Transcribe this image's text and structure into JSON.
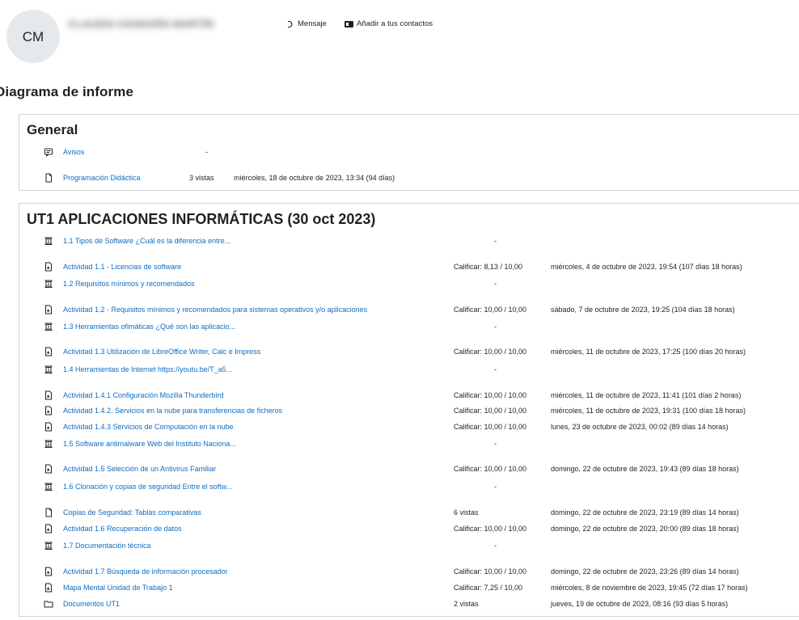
{
  "profile": {
    "initials": "CM",
    "name": "CLAUDIA SANDAÑA MARTÍN",
    "message_label": "Mensaje",
    "add_contact_label": "Añadir a tus contactos"
  },
  "page_title": "Diagrama de informe",
  "general": {
    "title": "General",
    "rows": [
      {
        "icon": "forum-icon",
        "title": "Avisos",
        "info": "",
        "dash": "-",
        "date": ""
      },
      {
        "icon": "page-icon",
        "title": "Programación Didáctica",
        "info": "3 vistas",
        "dash": "",
        "date": "miércoles, 18 de octubre de 2023, 13:34 (94 días)"
      }
    ]
  },
  "ut1": {
    "title": "UT1 APLICACIONES INFORMÁTICAS (30 oct 2023)",
    "rows": [
      {
        "icon": "book-icon",
        "title": "1.1 Tipos de Software ¿Cuál es la diferencia entre...",
        "info": "",
        "dash": "-",
        "date": ""
      },
      {
        "icon": "assignment-icon",
        "title": "Actividad 1.1 - Licencias de software",
        "info": "Calificar: 8,13 / 10,00",
        "dash": "",
        "date": "miércoles, 4 de octubre de 2023, 19:54 (107 días 18 horas)"
      },
      {
        "icon": "book-icon",
        "title": "1.2 Requisitos mínimos y recomendados",
        "info": "",
        "dash": "-",
        "date": ""
      },
      {
        "icon": "assignment-icon",
        "title": "Actividad 1.2 - Requisitos mínimos y recomendados para sistemas operativos y/o aplicaciones",
        "info": "Calificar: 10,00 / 10,00",
        "dash": "",
        "date": "sábado, 7 de octubre de 2023, 19:25 (104 días 18 horas)"
      },
      {
        "icon": "book-icon",
        "title": "1.3 Herramientas ofimáticas ¿Qué son las aplicacio...",
        "info": "",
        "dash": "-",
        "date": ""
      },
      {
        "icon": "assignment-icon",
        "title": "Actividad 1.3 Utilización de LibreOffice Writer, Calc e Impress",
        "info": "Calificar: 10,00 / 10,00",
        "dash": "",
        "date": "miércoles, 11 de octubre de 2023, 17:25 (100 días 20 horas)"
      },
      {
        "icon": "book-icon",
        "title": "1.4 Herramientas de Internet https://youtu.be/T_a5...",
        "info": "",
        "dash": "-",
        "date": ""
      },
      {
        "icon": "assignment-icon",
        "title": "Actividad 1.4.1 Configuración Mozilla Thunderbird",
        "info": "Calificar: 10,00 / 10,00",
        "dash": "",
        "date": "miércoles, 11 de octubre de 2023, 11:41 (101 días 2 horas)"
      },
      {
        "icon": "assignment-icon",
        "title": "Actividad 1.4.2. Servicios en la nube para transferencias de ficheros",
        "info": "Calificar: 10,00 / 10,00",
        "dash": "",
        "date": "miércoles, 11 de octubre de 2023, 19:31 (100 días 18 horas)"
      },
      {
        "icon": "assignment-icon",
        "title": "Actividad 1.4.3 Servicios de Computación en la nube",
        "info": "Calificar: 10,00 / 10,00",
        "dash": "",
        "date": "lunes, 23 de octubre de 2023, 00:02 (89 días 14 horas)"
      },
      {
        "icon": "book-icon",
        "title": "1.5 Software antimalware Web del Instituto Naciona...",
        "info": "",
        "dash": "-",
        "date": ""
      },
      {
        "icon": "assignment-icon",
        "title": "Actividad 1.5 Selección de un Antivirus Familiar",
        "info": "Calificar: 10,00 / 10,00",
        "dash": "",
        "date": "domingo, 22 de octubre de 2023, 19:43 (89 días 18 horas)"
      },
      {
        "icon": "book-icon",
        "title": "1.6 Clonación y copias de seguridad Entre el softw...",
        "info": "",
        "dash": "-",
        "date": ""
      },
      {
        "icon": "page-icon",
        "title": "Copias de Seguridad: Tablas comparativas",
        "info": "6 vistas",
        "dash": "",
        "date": "domingo, 22 de octubre de 2023, 23:19 (89 días 14 horas)"
      },
      {
        "icon": "assignment-icon",
        "title": "Actividad 1.6 Recuperación de datos",
        "info": "Calificar: 10,00 / 10,00",
        "dash": "",
        "date": "domingo, 22 de octubre de 2023, 20:00 (89 días 18 horas)"
      },
      {
        "icon": "book-icon",
        "title": "1.7 Documentación técnica",
        "info": "",
        "dash": "-",
        "date": ""
      },
      {
        "icon": "assignment-icon",
        "title": "Actividad 1.7 Búsqueda de información procesador",
        "info": "Calificar: 10,00 / 10,00",
        "dash": "",
        "date": "domingo, 22 de octubre de 2023, 23:26 (89 días 14 horas)"
      },
      {
        "icon": "assignment-icon",
        "title": "Mapa Mental Unidad de Trabajo 1",
        "info": "Calificar: 7,25 / 10,00",
        "dash": "",
        "date": "miércoles, 8 de noviembre de 2023, 19:45 (72 días 17 horas)"
      },
      {
        "icon": "folder-icon",
        "title": "Documentos UT1",
        "info": "2 vistas",
        "dash": "",
        "date": "jueves, 19 de octubre de 2023, 08:16 (93 días 5 horas)"
      }
    ]
  }
}
